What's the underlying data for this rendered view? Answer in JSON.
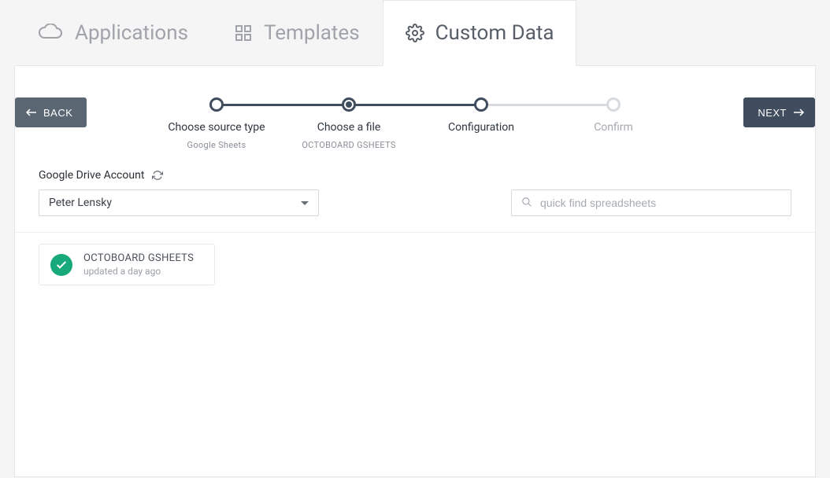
{
  "tabs": [
    {
      "label": "Applications",
      "icon": "cloud"
    },
    {
      "label": "Templates",
      "icon": "grid"
    },
    {
      "label": "Custom Data",
      "icon": "gear"
    }
  ],
  "active_tab_index": 2,
  "buttons": {
    "back": "BACK",
    "next": "NEXT"
  },
  "stepper": [
    {
      "label": "Choose source type",
      "sublabel": "Google Sheets",
      "state": "done"
    },
    {
      "label": "Choose a file",
      "sublabel": "OCTOBOARD GSHEETS",
      "state": "current"
    },
    {
      "label": "Configuration",
      "sublabel": "",
      "state": "done"
    },
    {
      "label": "Confirm",
      "sublabel": "",
      "state": "inactive"
    }
  ],
  "form": {
    "account_label": "Google Drive Account",
    "account_value": "Peter Lensky",
    "search_placeholder": "quick find spreadsheets"
  },
  "files": [
    {
      "title": "OCTOBOARD GSHEETS",
      "subtitle": "updated a day ago",
      "selected": true
    }
  ]
}
